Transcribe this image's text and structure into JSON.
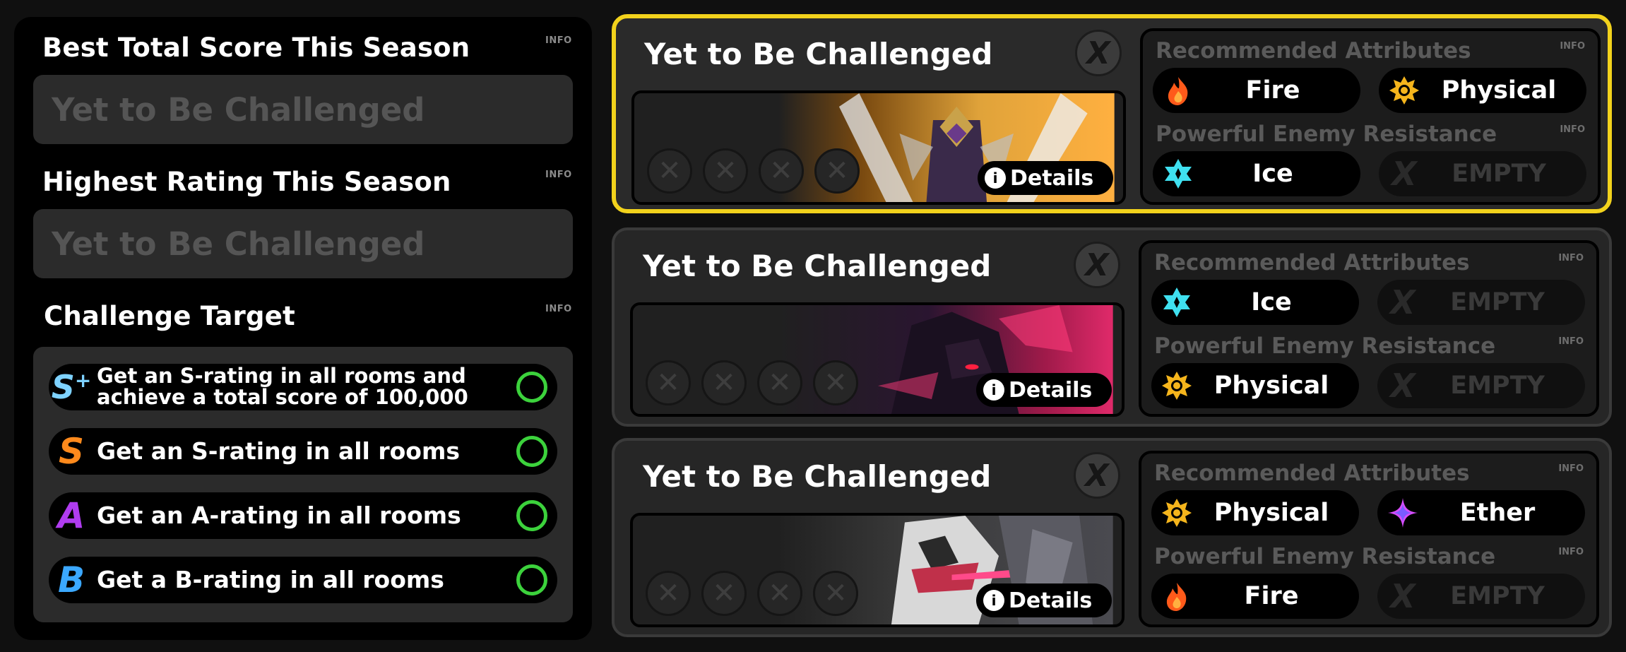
{
  "summary": {
    "best_score": {
      "title": "Best Total Score This Season",
      "info": "INFO",
      "value": "Yet to Be Challenged"
    },
    "highest_rating": {
      "title": "Highest Rating This Season",
      "info": "INFO",
      "value": "Yet to Be Challenged"
    },
    "challenge_target": {
      "title": "Challenge Target",
      "info": "INFO",
      "items": [
        {
          "rank": "S",
          "rank_suffix": "+",
          "text_line1": "Get an S-rating in all rooms and",
          "text_line2": "achieve a total score of 100,000"
        },
        {
          "rank": "S",
          "text": "Get an S-rating in all rooms"
        },
        {
          "rank": "A",
          "text": "Get an A-rating in all rooms"
        },
        {
          "rank": "B",
          "text": "Get a B-rating in all rooms"
        }
      ]
    }
  },
  "cards": [
    {
      "title": "Yet to Be Challenged",
      "rank_badge": "X",
      "details_label": "Details",
      "recommended_label": "Recommended Attributes",
      "resistance_label": "Powerful Enemy Resistance",
      "info": "INFO",
      "recommended": [
        {
          "label": "Fire",
          "icon": "fire-icon"
        },
        {
          "label": "Physical",
          "icon": "physical-icon"
        }
      ],
      "resistance": [
        {
          "label": "Ice",
          "icon": "ice-icon"
        },
        {
          "label": "EMPTY",
          "icon": "empty-x-icon"
        }
      ]
    },
    {
      "title": "Yet to Be Challenged",
      "rank_badge": "X",
      "details_label": "Details",
      "recommended_label": "Recommended Attributes",
      "resistance_label": "Powerful Enemy Resistance",
      "info": "INFO",
      "recommended": [
        {
          "label": "Ice",
          "icon": "ice-icon"
        },
        {
          "label": "EMPTY",
          "icon": "empty-x-icon"
        }
      ],
      "resistance": [
        {
          "label": "Physical",
          "icon": "physical-icon"
        },
        {
          "label": "EMPTY",
          "icon": "empty-x-icon"
        }
      ]
    },
    {
      "title": "Yet to Be Challenged",
      "rank_badge": "X",
      "details_label": "Details",
      "recommended_label": "Recommended Attributes",
      "resistance_label": "Powerful Enemy Resistance",
      "info": "INFO",
      "recommended": [
        {
          "label": "Physical",
          "icon": "physical-icon"
        },
        {
          "label": "Ether",
          "icon": "ether-icon"
        }
      ],
      "resistance": [
        {
          "label": "Fire",
          "icon": "fire-icon"
        },
        {
          "label": "EMPTY",
          "icon": "empty-x-icon"
        }
      ]
    }
  ],
  "colors": {
    "selected_border": "#f2d21c",
    "target_ring": "#3cd23c",
    "fire": "#ff5a1a",
    "ice": "#3fe0f0",
    "physical": "#f5b51c",
    "ether": "#d94cff"
  }
}
